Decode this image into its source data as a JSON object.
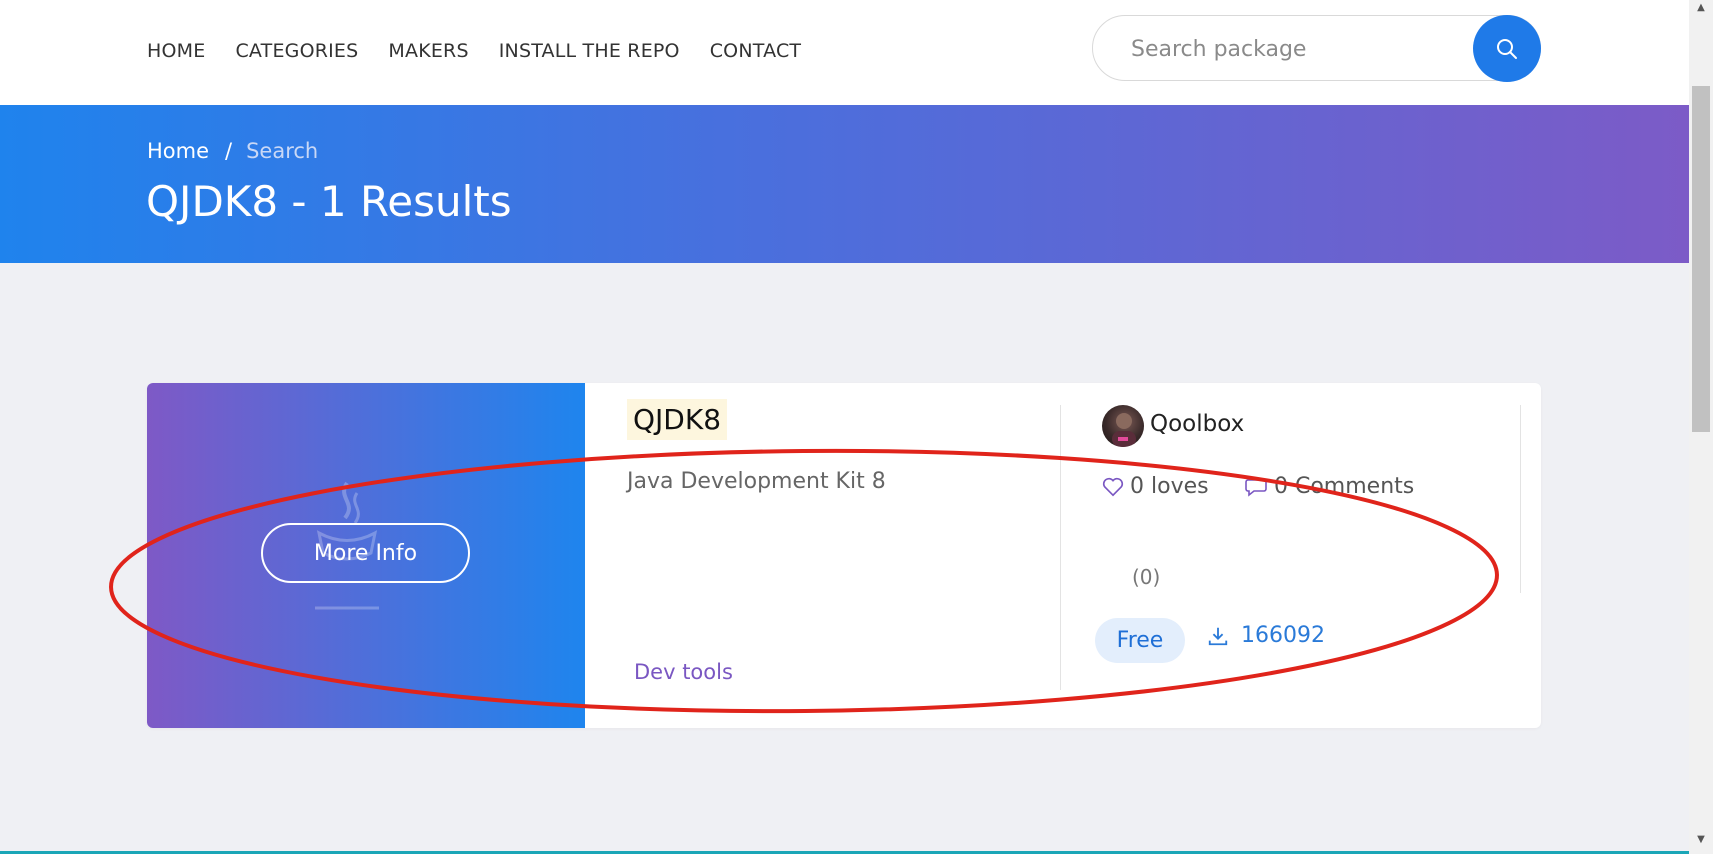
{
  "nav": {
    "items": [
      "HOME",
      "CATEGORIES",
      "MAKERS",
      "INSTALL THE REPO",
      "CONTACT"
    ]
  },
  "search": {
    "placeholder": "Search package",
    "button_icon": "search-icon"
  },
  "breadcrumb": {
    "home": "Home",
    "separator": "/",
    "current": "Search"
  },
  "page": {
    "title": "QJDK8 - 1 Results"
  },
  "result": {
    "more_info_label": "More Info",
    "name": "QJDK8",
    "description": "Java Development Kit 8",
    "category": "Dev tools",
    "maker": "Qoolbox",
    "loves": "0 loves",
    "comments": "0 Comments",
    "rating": "(0)",
    "price": "Free",
    "downloads": "166092"
  },
  "colors": {
    "accent": "#1f7ae8",
    "banner_start": "#1f83ed",
    "banner_end": "#7c5bc7",
    "annotation": "#e0241b"
  }
}
